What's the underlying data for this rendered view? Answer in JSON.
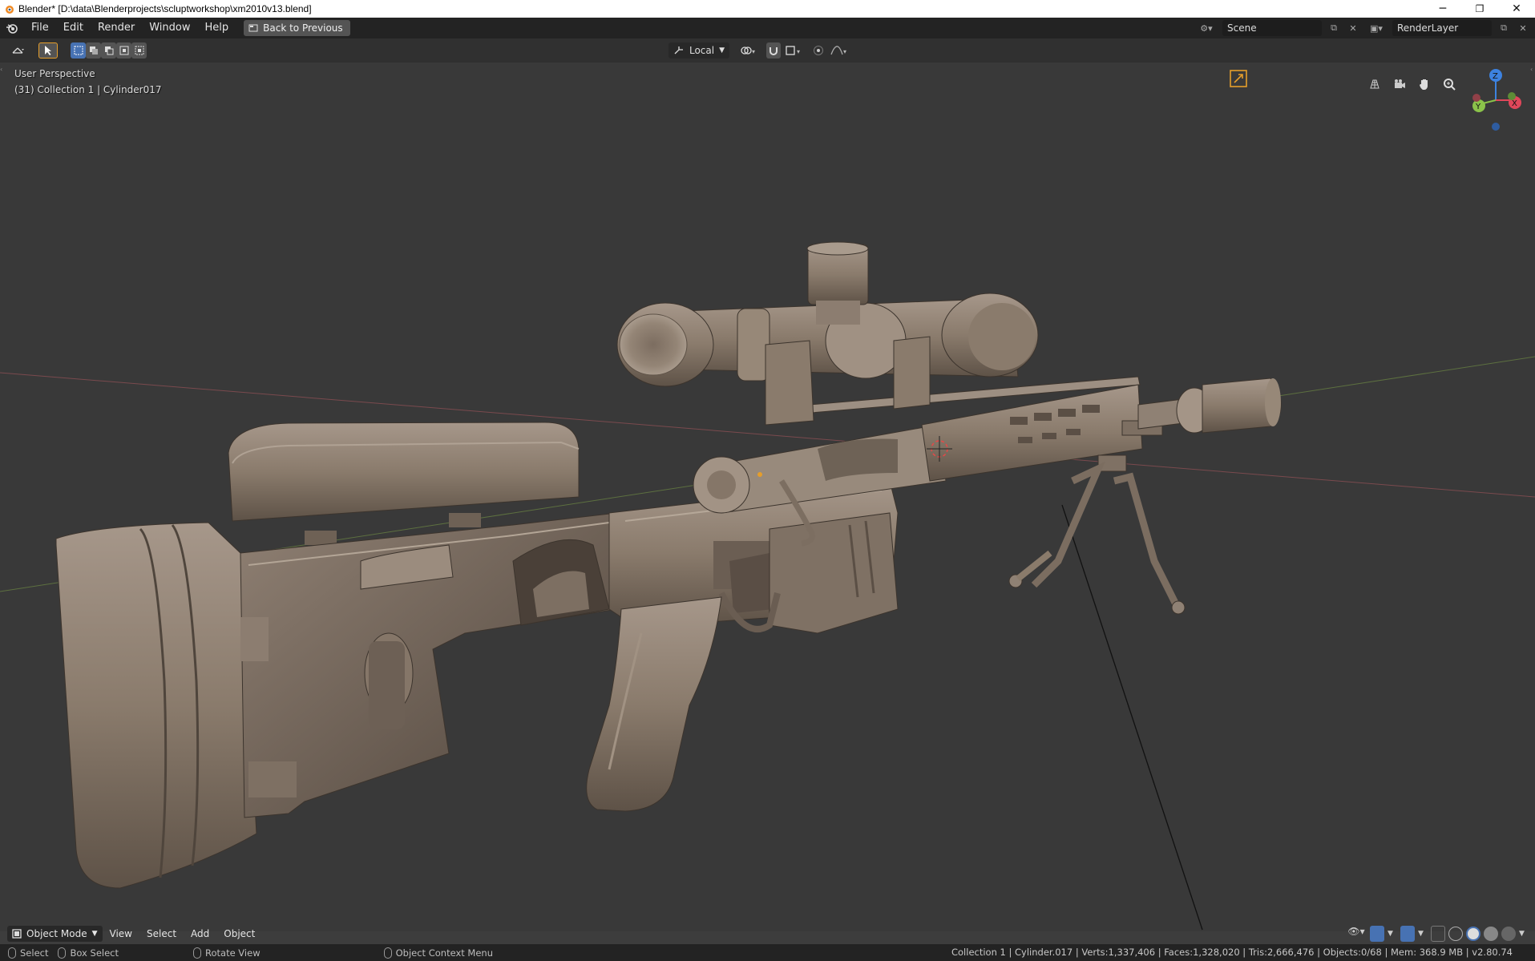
{
  "window": {
    "title": "Blender* [D:\\data\\Blenderprojects\\scluptworkshop\\xm2010v13.blend]",
    "minimize": "─",
    "restore": "❐",
    "close": "✕"
  },
  "topbar": {
    "menu": [
      "File",
      "Edit",
      "Render",
      "Window",
      "Help"
    ],
    "back_button": "Back to Previous",
    "scene_name": "Scene",
    "render_layer": "RenderLayer"
  },
  "toolheader": {
    "orientation": "Local"
  },
  "viewport": {
    "view_name": "User Perspective",
    "collection_info": "(31) Collection 1 | Cylinder017",
    "gizmo": {
      "z": "Z",
      "y": "Y",
      "x": "X"
    }
  },
  "bottom_header": {
    "mode": "Object Mode",
    "menus": [
      "View",
      "Select",
      "Add",
      "Object"
    ]
  },
  "statusbar": {
    "hints": [
      {
        "label": "Select"
      },
      {
        "label": "Box Select"
      },
      {
        "label": "Rotate View"
      },
      {
        "label": "Object Context Menu"
      }
    ],
    "stats": "Collection 1 | Cylinder.017 | Verts:1,337,406 | Faces:1,328,020 | Tris:2,666,476 | Objects:0/68 | Mem: 368.9 MB | v2.80.74"
  },
  "colors": {
    "model": "#8a7b6b",
    "accent": "#4772b3",
    "axis_x": "#e0475a",
    "axis_y": "#8bc34a",
    "axis_z": "#3d82e0"
  }
}
